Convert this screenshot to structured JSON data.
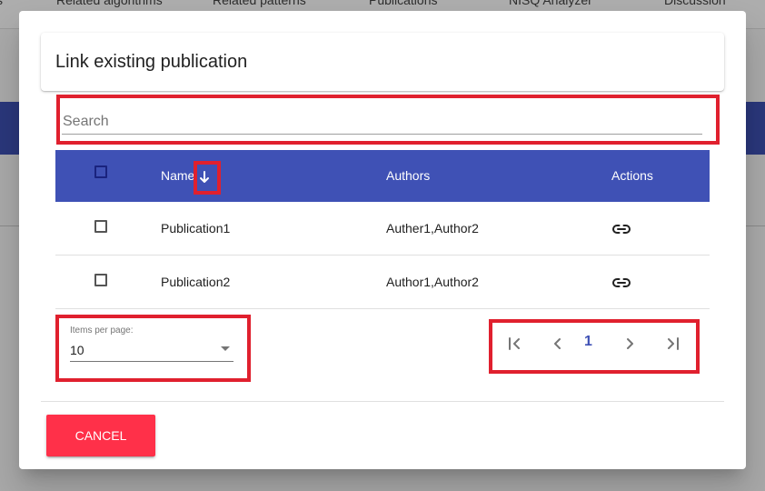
{
  "background": {
    "tabs": [
      "Related algorithms",
      "Related patterns",
      "Publications",
      "NISQ Analyzer",
      "Discussion"
    ]
  },
  "dialog": {
    "title": "Link existing publication",
    "search": {
      "placeholder": "Search",
      "value": ""
    },
    "table": {
      "columns": [
        "Name",
        "Authors",
        "Actions"
      ],
      "sort": {
        "column": "Name",
        "direction": "descending",
        "icon": "arrow-down-icon"
      },
      "rows": [
        {
          "name": "Publication1",
          "authors": "Auther1,Author2",
          "action_icon": "link-icon"
        },
        {
          "name": "Publication2",
          "authors": "Author1,Author2",
          "action_icon": "link-icon"
        }
      ]
    },
    "paginator": {
      "items_per_page_label": "Items per page:",
      "items_per_page_value": "10",
      "current_page": "1"
    },
    "cancel_label": "CANCEL"
  },
  "colors": {
    "primary": "#3f51b5",
    "warn_button": "#ff3049",
    "highlight_box": "#e0202e"
  }
}
